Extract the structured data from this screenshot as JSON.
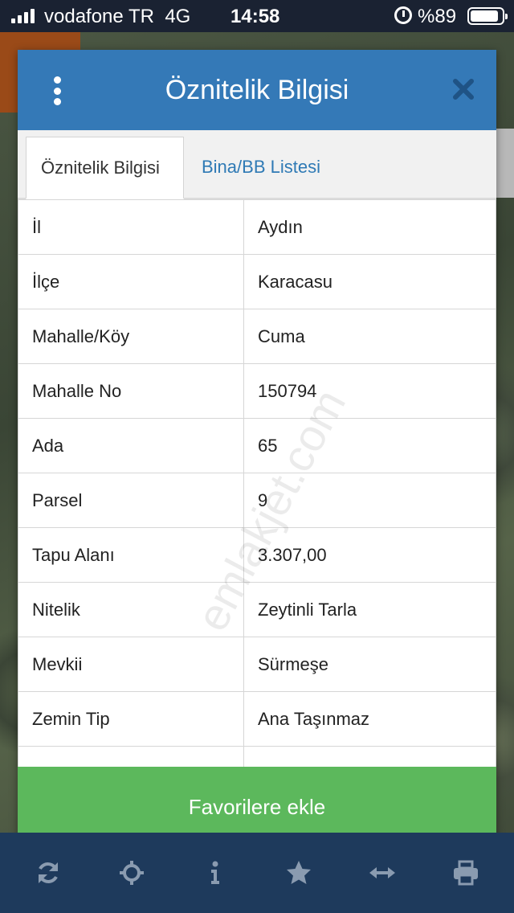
{
  "status_bar": {
    "carrier": "vodafone TR",
    "network": "4G",
    "time": "14:58",
    "battery": "%89",
    "battery_level": 0.89
  },
  "modal": {
    "title": "Öznitelik Bilgisi",
    "tabs": [
      {
        "label": "Öznitelik Bilgisi",
        "active": true
      },
      {
        "label": "Bina/BB Listesi",
        "active": false
      }
    ],
    "rows": [
      {
        "key": "İl",
        "value": "Aydın"
      },
      {
        "key": "İlçe",
        "value": "Karacasu"
      },
      {
        "key": "Mahalle/Köy",
        "value": "Cuma"
      },
      {
        "key": "Mahalle No",
        "value": "150794"
      },
      {
        "key": "Ada",
        "value": "65"
      },
      {
        "key": "Parsel",
        "value": "9"
      },
      {
        "key": "Tapu Alanı",
        "value": "3.307,00"
      },
      {
        "key": "Nitelik",
        "value": "Zeytinli Tarla"
      },
      {
        "key": "Mevkii",
        "value": "Sürmeşe"
      },
      {
        "key": "Zemin Tip",
        "value": "Ana Taşınmaz"
      }
    ],
    "favorite_button": "Favorilere ekle"
  },
  "watermark": "emlakjet.com",
  "toolbar": {
    "items": [
      "refresh-icon",
      "crosshair-icon",
      "info-icon",
      "star-icon",
      "measure-icon",
      "print-icon"
    ]
  },
  "colors": {
    "header": "#3479b7",
    "tab_link": "#2f7ab5",
    "favorite": "#5cb85c",
    "toolbar": "#1e3a5c",
    "toolbar_icon": "#8a9bb0"
  }
}
